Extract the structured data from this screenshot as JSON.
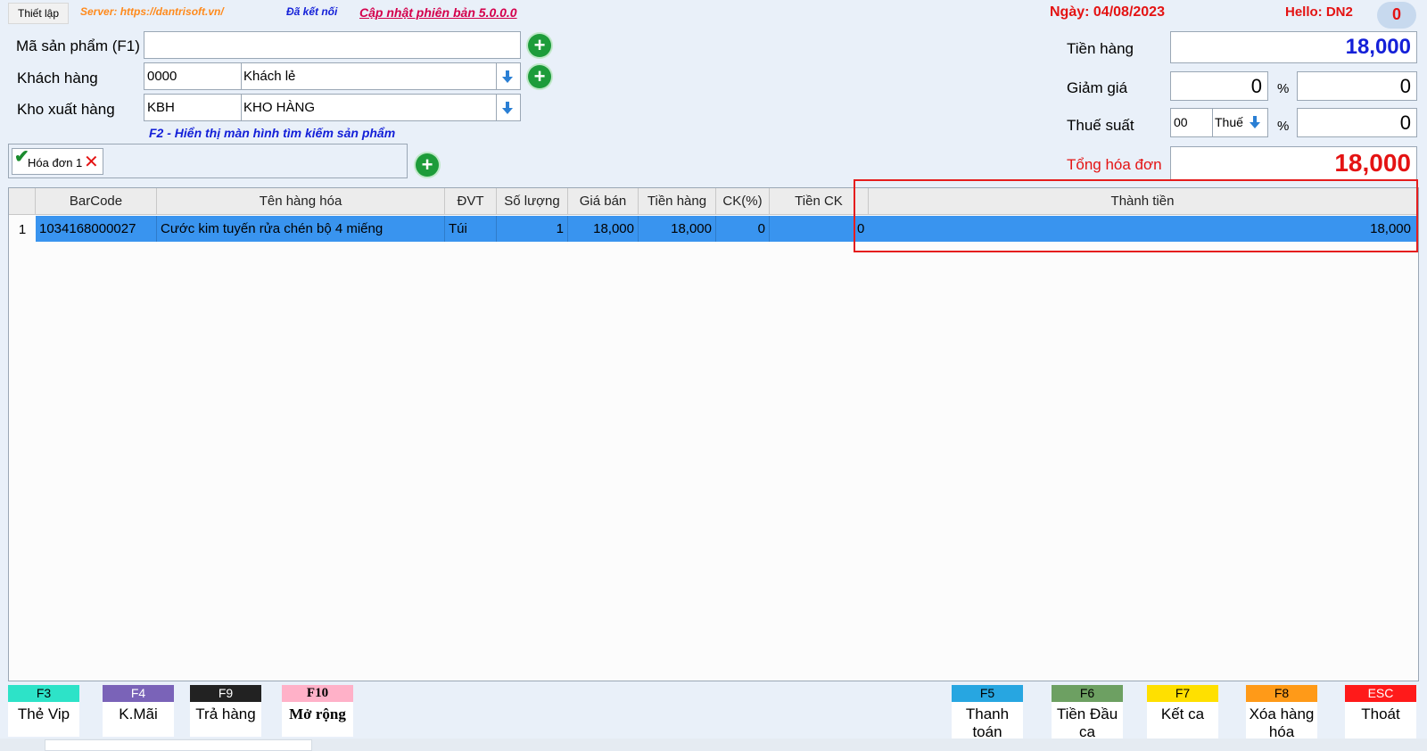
{
  "topbar": {
    "setup_label": "Thiết lập",
    "server": "Server: https://dantrisoft.vn/",
    "status": "Đã kết nối",
    "update": "Cập nhật phiên bản 5.0.0.0",
    "date": "Ngày: 04/08/2023",
    "hello": "Hello: DN2",
    "notification_count": "0"
  },
  "form": {
    "product_code_label": "Mã sản phẩm (F1)",
    "product_code_value": "",
    "customer_label": "Khách hàng",
    "customer_code": "0000",
    "customer_name": "Khách lẻ",
    "warehouse_label": "Kho xuất hàng",
    "warehouse_code": "KBH",
    "warehouse_name": "KHO HÀNG",
    "hint": "F2 - Hiển thị màn hình tìm kiếm sản phẩm"
  },
  "invoice_tab": {
    "label": "Hóa đơn 1"
  },
  "totals": {
    "subtotal_label": "Tiền hàng",
    "subtotal_value": "18,000",
    "discount_label": "Giảm giá",
    "discount_percent": "0",
    "discount_amount": "0",
    "percent_sign": "%",
    "tax_label": "Thuế suất",
    "tax_code": "00",
    "tax_name": "Thuế",
    "tax_amount": "0",
    "grand_total_label": "Tổng hóa đơn",
    "grand_total_value": "18,000"
  },
  "table": {
    "columns": [
      "BarCode",
      "Tên hàng hóa",
      "ĐVT",
      "Số lượng",
      "Giá bán",
      "Tiền hàng",
      "CK(%)",
      "Tiền CK",
      "Thành tiền"
    ],
    "rows": [
      {
        "index": "1",
        "barcode": "1034168000027",
        "name": "Cước kim tuyến rửa chén bộ 4 miếng",
        "unit": "Túi",
        "qty": "1",
        "price": "18,000",
        "amount": "18,000",
        "discount_pct": "0",
        "discount_amt": "0",
        "total": "18,000"
      }
    ]
  },
  "buttons": [
    {
      "key": "F3",
      "label": "Thẻ Vip",
      "color": "#2de3c8",
      "key_text_color": "#000000"
    },
    {
      "key": "F4",
      "label": "K.Mãi",
      "color": "#7a63b8",
      "key_text_color": "#ffffff"
    },
    {
      "key": "F9",
      "label": "Trả hàng",
      "color": "#222222",
      "key_text_color": "#ffffff"
    },
    {
      "key": "F10",
      "label": "Mở rộng",
      "color": "#ffb1c8",
      "key_text_color": "#000000"
    },
    {
      "key": "F5",
      "label": "Thanh toán",
      "color": "#27a6e1",
      "key_text_color": "#000000"
    },
    {
      "key": "F6",
      "label": "Tiền Đầu ca",
      "color": "#6da062",
      "key_text_color": "#000000"
    },
    {
      "key": "F7",
      "label": "Kết ca",
      "color": "#ffe000",
      "key_text_color": "#000000"
    },
    {
      "key": "F8",
      "label": "Xóa hàng hóa",
      "color": "#ff9a18",
      "key_text_color": "#000000"
    },
    {
      "key": "ESC",
      "label": "Thoát",
      "color": "#ff1a1a",
      "key_text_color": "#ffffff"
    }
  ]
}
